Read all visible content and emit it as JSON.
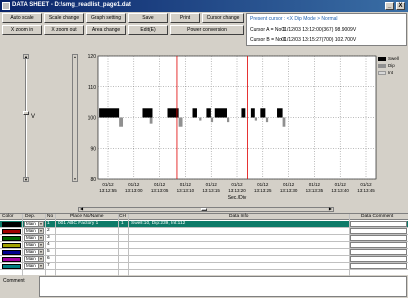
{
  "window": {
    "title": "DATA SHEET - D:\\smg_readlist_page1.dat",
    "min_glyph": "_",
    "close_glyph": "X"
  },
  "toolbar": {
    "row1": [
      "Auto scale",
      "Scale change",
      "Graph setting",
      "Save",
      "Print",
      "Cursor change"
    ],
    "row2": [
      "X zoom in",
      "X zoom out",
      "Area change",
      "Edit(E)",
      "Power conversion"
    ]
  },
  "info": {
    "present_cursor": "Present cursor : <X Dip Mode > Normal",
    "cursor_a_label": "Cursor A = No 1",
    "cursor_a_value": "01/12/03 13:12:00(367) 98.9009V",
    "cursor_b_label": "Cursor B = No 1",
    "cursor_b_value": "01/12/03 13:15:27(700) 102.700V"
  },
  "vslider": {
    "label": "V"
  },
  "chart_data": {
    "type": "line",
    "ylim": [
      80,
      120
    ],
    "yticks": [
      80,
      90,
      100,
      110,
      120
    ],
    "xlabel": "Sec./Div",
    "xticks": [
      [
        "01/12",
        "13:12:55"
      ],
      [
        "01/12",
        "13:13:00"
      ],
      [
        "01/12",
        "13:13:05"
      ],
      [
        "01/12",
        "13:13:10"
      ],
      [
        "01/12",
        "13:13:15"
      ],
      [
        "01/12",
        "13:13:20"
      ],
      [
        "01/12",
        "13:13:25"
      ],
      [
        "01/12",
        "13:13:30"
      ],
      [
        "01/12",
        "13:13:35"
      ],
      [
        "01/12",
        "13:13:40"
      ],
      [
        "01/12",
        "13:13:45"
      ]
    ],
    "legend": [
      {
        "name": "Swell",
        "color": "#000000"
      },
      {
        "name": "Dip",
        "color": "#909090"
      },
      {
        "name": "Int",
        "color": "#d8d8d8"
      }
    ],
    "events": [
      {
        "type": "Swell",
        "start": 0.2,
        "end": 3.8,
        "top": 103,
        "bottom": 100
      },
      {
        "type": "Dip",
        "start": 3.8,
        "end": 4.5,
        "top": 100,
        "bottom": 97
      },
      {
        "type": "Swell",
        "start": 8.0,
        "end": 9.8,
        "top": 103,
        "bottom": 100
      },
      {
        "type": "Dip",
        "start": 9.3,
        "end": 9.8,
        "top": 100,
        "bottom": 98
      },
      {
        "type": "Swell",
        "start": 12.5,
        "end": 14.5,
        "top": 103,
        "bottom": 100
      },
      {
        "type": "Dip",
        "start": 14.5,
        "end": 15.2,
        "top": 100,
        "bottom": 97
      },
      {
        "type": "Swell",
        "start": 17.0,
        "end": 17.8,
        "top": 103,
        "bottom": 100
      },
      {
        "type": "Dip",
        "start": 18.2,
        "end": 18.6,
        "top": 100,
        "bottom": 99
      },
      {
        "type": "Swell",
        "start": 19.5,
        "end": 20.3,
        "top": 103,
        "bottom": 100
      },
      {
        "type": "Dip",
        "start": 20.3,
        "end": 20.7,
        "top": 100,
        "bottom": 98.5
      },
      {
        "type": "Swell",
        "start": 21.0,
        "end": 23.2,
        "top": 103,
        "bottom": 100
      },
      {
        "type": "Dip",
        "start": 23.2,
        "end": 23.6,
        "top": 100,
        "bottom": 98.5
      },
      {
        "type": "Swell",
        "start": 25.8,
        "end": 26.5,
        "top": 103,
        "bottom": 100
      },
      {
        "type": "Swell",
        "start": 27.5,
        "end": 28.2,
        "top": 103,
        "bottom": 100
      },
      {
        "type": "Dip",
        "start": 28.2,
        "end": 28.6,
        "top": 100,
        "bottom": 99
      },
      {
        "type": "Swell",
        "start": 29.2,
        "end": 30.1,
        "top": 103,
        "bottom": 100
      },
      {
        "type": "Dip",
        "start": 30.2,
        "end": 30.6,
        "top": 100,
        "bottom": 98.5
      },
      {
        "type": "Swell",
        "start": 32.2,
        "end": 33.2,
        "top": 103,
        "bottom": 100
      },
      {
        "type": "Dip",
        "start": 33.2,
        "end": 33.7,
        "top": 100,
        "bottom": 97
      }
    ],
    "cursors": [
      14.2,
      26.9
    ],
    "xrange": [
      0,
      50
    ]
  },
  "grid": {
    "headers": {
      "color": "Color",
      "dep": "Dep.",
      "no": "No",
      "place": "Place No/Name",
      "ch": "CH",
      "info": "Data Info",
      "comment": "Data Comment"
    },
    "rows": [
      {
        "color": "#000000",
        "dep": "Main",
        "no": "1",
        "place": "001 ABC Factory 1",
        "ch": "1",
        "info": "Swell:10, Dip:239, Int:112",
        "selected": true
      },
      {
        "color": "#a00000",
        "dep": "Main",
        "no": "2",
        "place": "",
        "ch": "",
        "info": "",
        "selected": false
      },
      {
        "color": "#006000",
        "dep": "Main",
        "no": "3",
        "place": "",
        "ch": "",
        "info": "",
        "selected": false
      },
      {
        "color": "#a0a000",
        "dep": "Main",
        "no": "4",
        "place": "",
        "ch": "",
        "info": "",
        "selected": false
      },
      {
        "color": "#000090",
        "dep": "Main",
        "no": "5",
        "place": "",
        "ch": "",
        "info": "",
        "selected": false
      },
      {
        "color": "#a000a0",
        "dep": "Main",
        "no": "6",
        "place": "",
        "ch": "",
        "info": "",
        "selected": false
      },
      {
        "color": "#008080",
        "dep": "Main",
        "no": "7",
        "place": "",
        "ch": "",
        "info": "",
        "selected": false
      }
    ]
  },
  "comment": {
    "label": "Comment"
  }
}
